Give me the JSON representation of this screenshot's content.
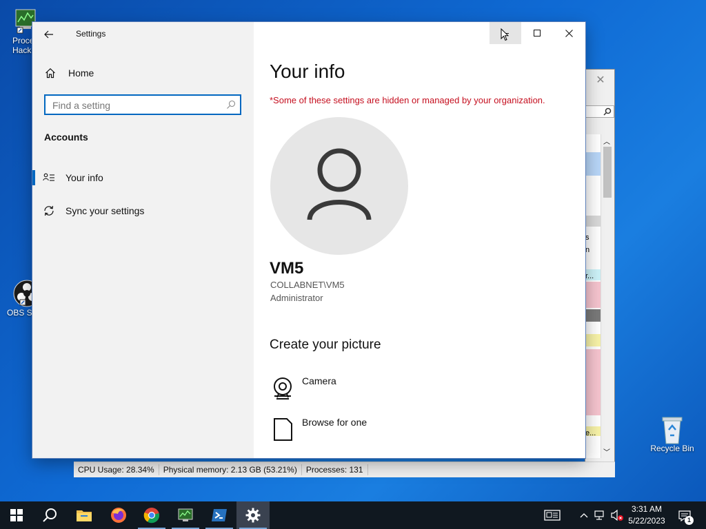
{
  "desktop": {
    "icons": [
      {
        "label": "Proce\nHacke",
        "icon": "process-hacker-icon"
      },
      {
        "label": "OBS Stu",
        "icon": "obs-studio-icon"
      },
      {
        "label": "Recycle Bin",
        "icon": "recycle-bin-icon"
      }
    ]
  },
  "background_window": {
    "statusbar": {
      "cpu": "CPU Usage: 28.34%",
      "memory": "Physical memory: 2.13 GB (53.21%)",
      "processes": "Processes: 131"
    },
    "side_texts": [
      "s",
      "n",
      "r...",
      "e..."
    ]
  },
  "settings": {
    "title": "Settings",
    "nav": {
      "home_label": "Home",
      "search_placeholder": "Find a setting",
      "section_heading": "Accounts",
      "items": [
        {
          "label": "Your info",
          "icon": "person-list-icon",
          "selected": true
        },
        {
          "label": "Sync your settings",
          "icon": "sync-icon",
          "selected": false
        }
      ]
    },
    "content": {
      "heading": "Your info",
      "managed_notice": "*Some of these settings are hidden or managed by your organization.",
      "user": {
        "name": "VM5",
        "account": "COLLABNET\\VM5",
        "role": "Administrator"
      },
      "create_picture_heading": "Create your picture",
      "options": [
        {
          "label": "Camera",
          "icon": "camera-icon"
        },
        {
          "label": "Browse for one",
          "icon": "file-icon"
        }
      ]
    }
  },
  "taskbar": {
    "time": "3:31 AM",
    "date": "5/22/2023",
    "notification_count": "1",
    "apps": [
      "start-icon",
      "search-icon",
      "file-explorer-icon",
      "firefox-icon",
      "chrome-icon",
      "process-hacker-icon",
      "powershell-icon",
      "settings-icon"
    ]
  },
  "colors": {
    "accent": "#0067c0",
    "warning_text": "#c50f1f",
    "nav_bg": "#f2f2f2",
    "taskbar_bg": "#101820"
  }
}
